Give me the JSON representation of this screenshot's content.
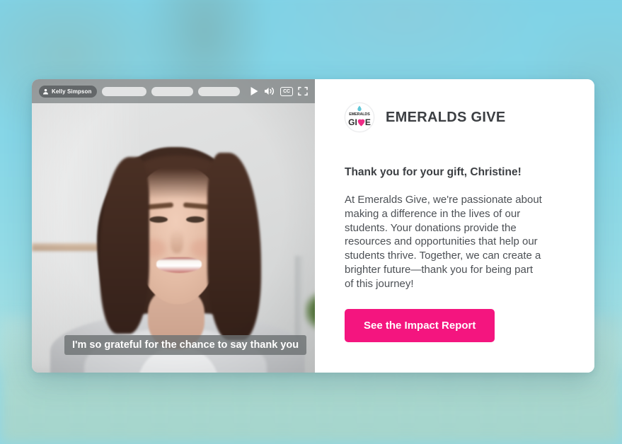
{
  "video_player": {
    "speaker_name": "Kelly Simpson",
    "speaker_icon": "person-icon",
    "progress_segments": [
      {
        "name": "chapter-1"
      },
      {
        "name": "chapter-2"
      },
      {
        "name": "chapter-3"
      }
    ],
    "controls": {
      "play_icon": "play-icon",
      "volume_icon": "volume-icon",
      "captions_label": "CC",
      "captions_icon": "closed-captions-icon",
      "fullscreen_icon": "fullscreen-icon"
    },
    "caption_text": "I'm so grateful for the chance to say thank you"
  },
  "panel": {
    "logo": {
      "top_word": "EMERALDS",
      "bottom_left": "GI",
      "bottom_right": "E",
      "heart_icon": "heart-icon",
      "droplet_icon": "droplet-icon"
    },
    "brand_name": "EMERALDS GIVE",
    "greeting": "Thank you for your gift, Christine!",
    "body": "At Emeralds Give, we're passionate about making a difference in the lives of our students. Your donations provide the resources and opportunities that help our students thrive. Together, we can create a brighter future—thank you for being part of this journey!",
    "cta_label": "See the Impact Report"
  },
  "colors": {
    "cta_pink": "#f4157f",
    "heart_pink": "#ef2e87",
    "background_cyan": "#8ed8e8",
    "text_dark": "#3c3f43",
    "body_text": "#4c5055"
  }
}
